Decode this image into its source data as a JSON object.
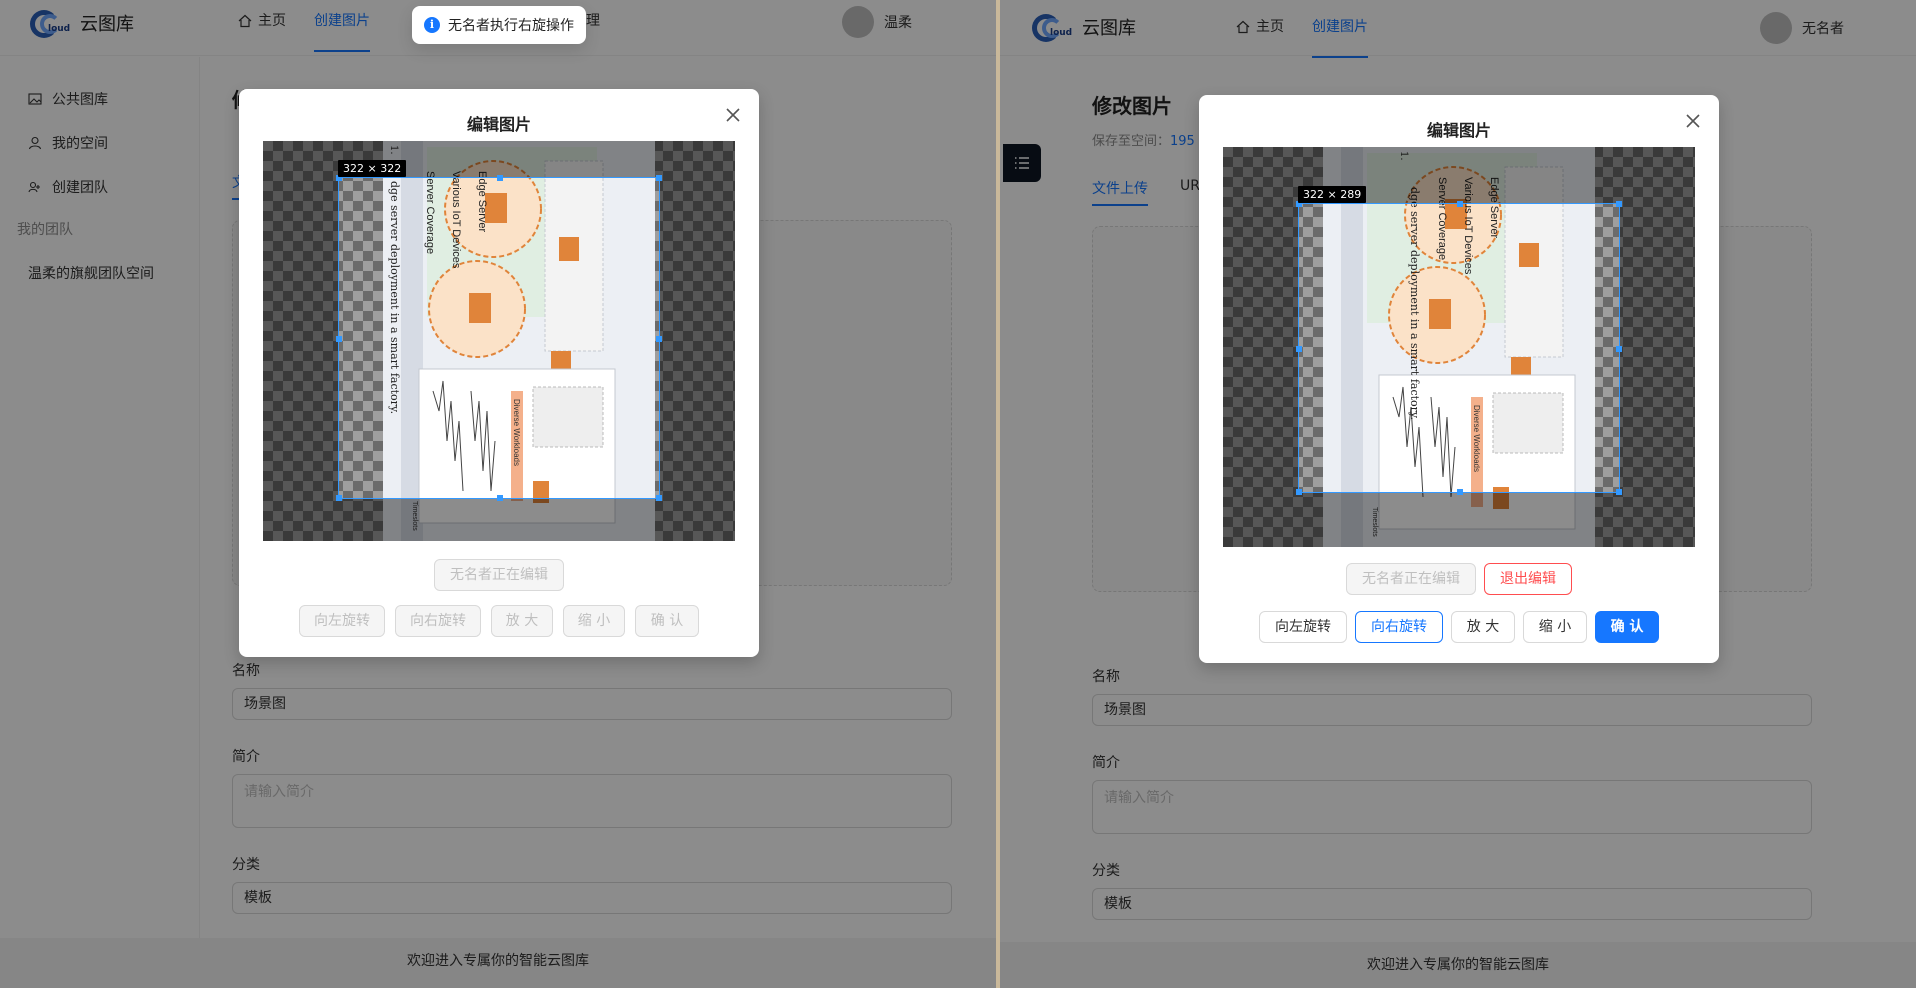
{
  "app": {
    "name": "云图库",
    "logo_text": "loud"
  },
  "nav": {
    "home": "主页",
    "create": "创建图片",
    "space_manage": "空间管理"
  },
  "sidebar": {
    "public": "公共图库",
    "my_space": "我的空间",
    "create_team": "创建团队",
    "my_team_group": "我的团队",
    "team_space": "温柔的旗舰团队空间"
  },
  "page": {
    "title": "修改图片",
    "save_to_label": "保存至空间：",
    "save_to_value": "195",
    "tab_file": "文件上传",
    "tab_url": "URL"
  },
  "form": {
    "name_label": "名称",
    "name_value": "场景图",
    "intro_label": "简介",
    "intro_placeholder": "请输入简介",
    "category_label": "分类",
    "category_value": "模板"
  },
  "footer": {
    "text": "欢迎进入专属你的智能云图库"
  },
  "modal": {
    "title": "编辑图片",
    "editing_status": "无名者正在编辑",
    "exit_edit": "退出编辑",
    "rotate_left": "向左旋转",
    "rotate_right": "向右旋转",
    "zoom_in": "放 大",
    "zoom_out": "缩 小",
    "confirm": "确 认"
  },
  "left_window": {
    "user": "温柔",
    "crop_size": "322 × 322",
    "toast": "无名者执行右旋操作"
  },
  "right_window": {
    "user": "无名者",
    "crop_size": "322 × 289"
  },
  "image": {
    "edge_server": "Edge Server",
    "server_coverage": "Server Coverage",
    "iot_devices": "Various IoT Devices",
    "caption": "dge server deployment in a smart factory.",
    "timeslots": "Timeslots",
    "diverse_workloads": "Diverse Workloads",
    "number": "1."
  },
  "colors": {
    "accent": "#1677ff",
    "danger": "#ff4d4f",
    "orange": "#e0843a"
  }
}
